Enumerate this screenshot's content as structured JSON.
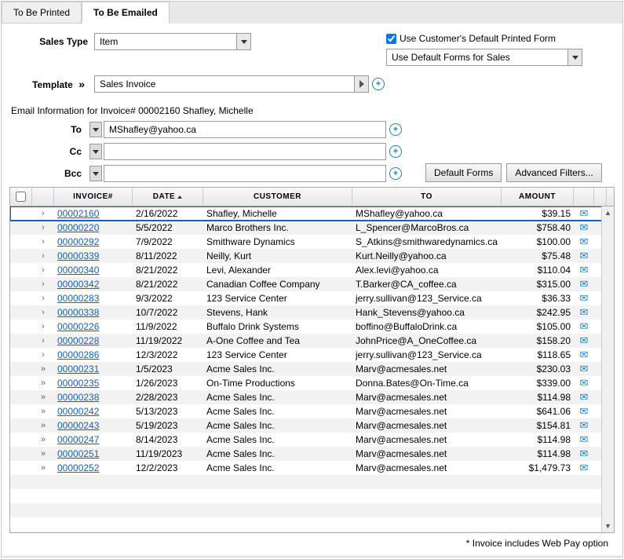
{
  "tabs": {
    "printed": "To Be Printed",
    "emailed": "To Be Emailed"
  },
  "salesType": {
    "label": "Sales Type",
    "value": "Item"
  },
  "defaultPrintedForm": {
    "label": "Use Customer's Default Printed Form",
    "checked": true
  },
  "formsDropdown": {
    "value": "Use Default Forms for Sales"
  },
  "template": {
    "label": "Template",
    "value": "Sales Invoice"
  },
  "emailInfo": "Email Information for Invoice# 00002160 Shafley, Michelle",
  "to": {
    "label": "To",
    "value": "MShafley@yahoo.ca"
  },
  "cc": {
    "label": "Cc",
    "value": ""
  },
  "bcc": {
    "label": "Bcc",
    "value": ""
  },
  "buttons": {
    "defaultForms": "Default Forms",
    "advancedFilters": "Advanced Filters..."
  },
  "columns": {
    "invoice": "INVOICE#",
    "date": "DATE",
    "customer": "CUSTOMER",
    "to": "TO",
    "amount": "AMOUNT"
  },
  "rows": [
    {
      "exp": "›",
      "inv": "00002160",
      "date": "2/16/2022",
      "cust": "Shafley, Michelle",
      "to": "MShafley@yahoo.ca",
      "amt": "$39.15",
      "selected": true
    },
    {
      "exp": "›",
      "inv": "00000220",
      "date": "5/5/2022",
      "cust": "Marco Brothers Inc.",
      "to": "L_Spencer@MarcoBros.ca",
      "amt": "$758.40"
    },
    {
      "exp": "›",
      "inv": "00000292",
      "date": "7/9/2022",
      "cust": "Smithware Dynamics",
      "to": "S_Atkins@smithwaredynamics.ca",
      "amt": "$100.00"
    },
    {
      "exp": "›",
      "inv": "00000339",
      "date": "8/11/2022",
      "cust": "Neilly, Kurt",
      "to": "Kurt.Neilly@yahoo.ca",
      "amt": "$75.48"
    },
    {
      "exp": "›",
      "inv": "00000340",
      "date": "8/21/2022",
      "cust": "Levi, Alexander",
      "to": "Alex.levi@yahoo.ca",
      "amt": "$110.04"
    },
    {
      "exp": "›",
      "inv": "00000342",
      "date": "8/21/2022",
      "cust": "Canadian Coffee Company",
      "to": "T.Barker@CA_coffee.ca",
      "amt": "$315.00"
    },
    {
      "exp": "›",
      "inv": "00000283",
      "date": "9/3/2022",
      "cust": "123 Service Center",
      "to": "jerry.sullivan@123_Service.ca",
      "amt": "$36.33"
    },
    {
      "exp": "›",
      "inv": "00000338",
      "date": "10/7/2022",
      "cust": "Stevens, Hank",
      "to": "Hank_Stevens@yahoo.ca",
      "amt": "$242.95"
    },
    {
      "exp": "›",
      "inv": "00000226",
      "date": "11/9/2022",
      "cust": "Buffalo Drink Systems",
      "to": "boffino@BuffaloDrink.ca",
      "amt": "$105.00"
    },
    {
      "exp": "›",
      "inv": "00000228",
      "date": "11/19/2022",
      "cust": "A-One Coffee and Tea",
      "to": "JohnPrice@A_OneCoffee.ca",
      "amt": "$158.20"
    },
    {
      "exp": "›",
      "inv": "00000286",
      "date": "12/3/2022",
      "cust": "123 Service Center",
      "to": "jerry.sullivan@123_Service.ca",
      "amt": "$118.65"
    },
    {
      "exp": "»",
      "inv": "00000231",
      "date": "1/5/2023",
      "cust": "Acme Sales Inc.",
      "to": "Marv@acmesales.net",
      "amt": "$230.03"
    },
    {
      "exp": "»",
      "inv": "00000235",
      "date": "1/26/2023",
      "cust": "On-Time Productions",
      "to": "Donna.Bates@On-Time.ca",
      "amt": "$339.00"
    },
    {
      "exp": "»",
      "inv": "00000238",
      "date": "2/28/2023",
      "cust": "Acme Sales Inc.",
      "to": "Marv@acmesales.net",
      "amt": "$114.98"
    },
    {
      "exp": "»",
      "inv": "00000242",
      "date": "5/13/2023",
      "cust": "Acme Sales Inc.",
      "to": "Marv@acmesales.net",
      "amt": "$641.06"
    },
    {
      "exp": "»",
      "inv": "00000243",
      "date": "5/19/2023",
      "cust": "Acme Sales Inc.",
      "to": "Marv@acmesales.net",
      "amt": "$154.81"
    },
    {
      "exp": "»",
      "inv": "00000247",
      "date": "8/14/2023",
      "cust": "Acme Sales Inc.",
      "to": "Marv@acmesales.net",
      "amt": "$114.98"
    },
    {
      "exp": "»",
      "inv": "00000251",
      "date": "11/19/2023",
      "cust": "Acme Sales Inc.",
      "to": "Marv@acmesales.net",
      "amt": "$114.98"
    },
    {
      "exp": "»",
      "inv": "00000252",
      "date": "12/2/2023",
      "cust": "Acme Sales Inc.",
      "to": "Marv@acmesales.net",
      "amt": "$1,479.73"
    }
  ],
  "footer": "* Invoice includes Web Pay option"
}
